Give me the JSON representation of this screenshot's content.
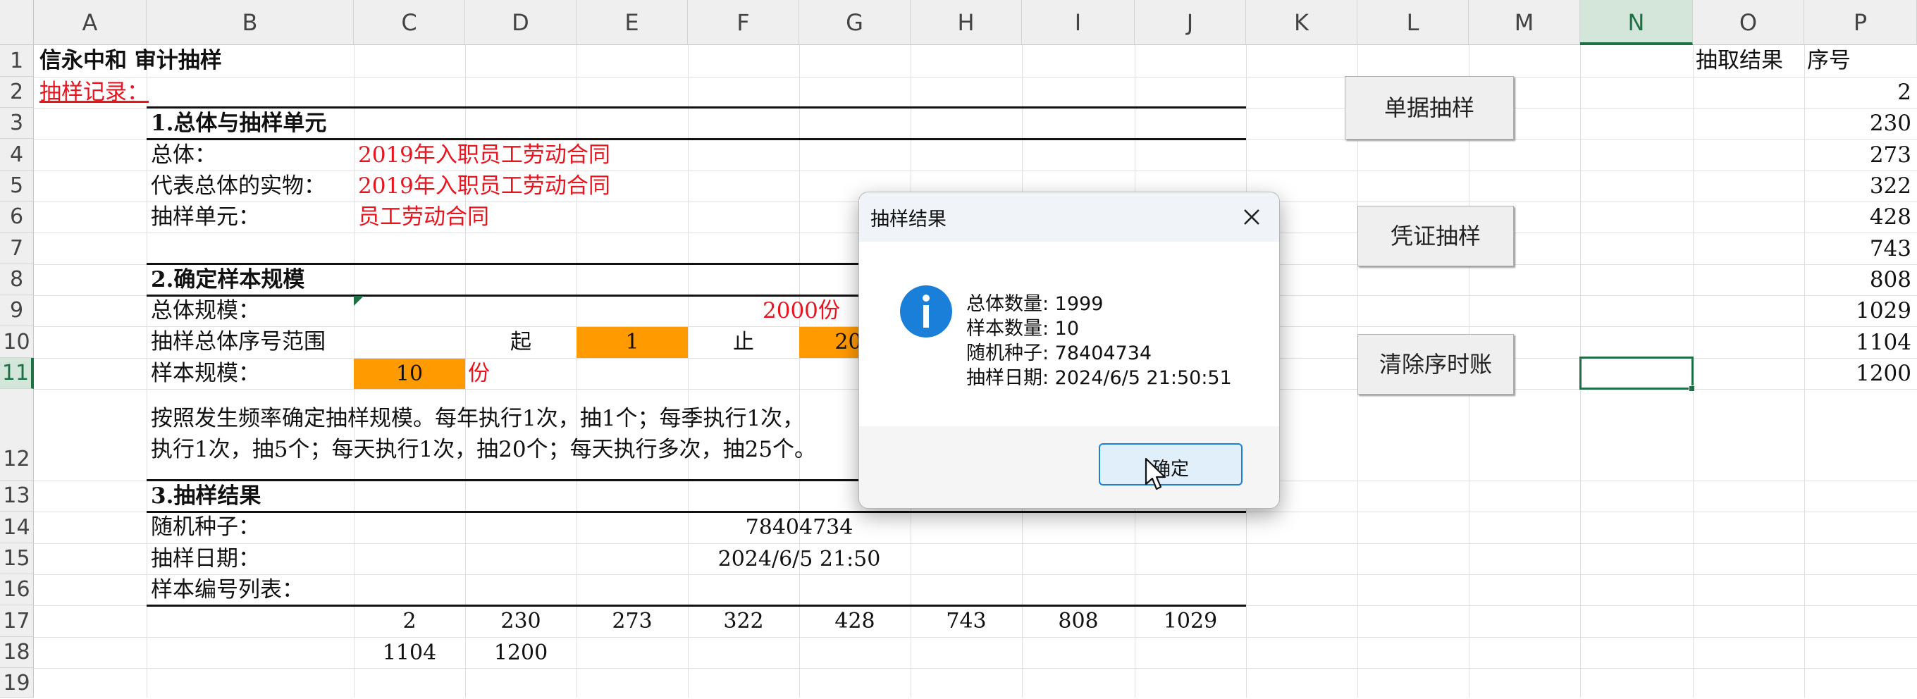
{
  "spreadsheet": {
    "columns": [
      "A",
      "B",
      "C",
      "D",
      "E",
      "F",
      "G",
      "H",
      "I",
      "J",
      "K",
      "L",
      "M",
      "N",
      "O",
      "P"
    ],
    "rows": [
      "1",
      "2",
      "3",
      "4",
      "5",
      "6",
      "7",
      "8",
      "9",
      "10",
      "11",
      "12",
      "13",
      "14",
      "15",
      "16",
      "17",
      "18",
      "19"
    ],
    "selected_column": "N",
    "selected_row": "11"
  },
  "sheet": {
    "a1": "信永中和  审计抽样",
    "a2": "抽样记录：",
    "section1_title": "1.总体与抽样单元",
    "population_label": "总体：",
    "population_value": "2019年入职员工劳动合同",
    "physical_label": "代表总体的实物：",
    "physical_value": "2019年入职员工劳动合同",
    "unit_label": "抽样单元：",
    "unit_value": "员工劳动合同",
    "section2_title": "2.确定样本规模",
    "pop_size_label": "总体规模：",
    "pop_size_value": "2000份",
    "range_label": "抽样总体序号范围",
    "range_start_label": "起",
    "range_start_value": "1",
    "range_end_label": "止",
    "range_end_value": "200",
    "sample_size_label": "样本规模：",
    "sample_size_value": "10",
    "sample_size_unit": "份",
    "note_line1": "按照发生频率确定抽样规模。每年执行1次，抽1个；每季执行1次，",
    "note_line2": "执行1次，抽5个；每天执行1次，抽20个；每天执行多次，抽25个。",
    "section3_title": "3.抽样结果",
    "seed_label": "随机种子：",
    "seed_value": "78404734",
    "date_label": "抽样日期：",
    "date_value": "2024/6/5 21:50",
    "list_label": "样本编号列表：",
    "row17": [
      "2",
      "230",
      "273",
      "322",
      "428",
      "743",
      "808",
      "1029"
    ],
    "row18": [
      "1104",
      "1200"
    ],
    "o1": "抽取结果",
    "p1": "序号",
    "p_values": [
      "2",
      "230",
      "273",
      "322",
      "428",
      "743",
      "808",
      "1029",
      "1104",
      "1200"
    ]
  },
  "buttons": {
    "doc_sampling": "单据抽样",
    "voucher_sampling": "凭证抽样",
    "clear_ledger": "清除序时账"
  },
  "dialog": {
    "title": "抽样结果",
    "lines": [
      "总体数量: 1999",
      "样本数量: 10",
      "随机种子: 78404734",
      "抽样日期: 2024/6/5 21:50:51"
    ],
    "ok_label": "确定"
  },
  "colors": {
    "accent_green": "#1e7145",
    "text_red": "#e8141e",
    "fill_orange": "#ff9a00",
    "info_blue": "#1a7fd8"
  }
}
